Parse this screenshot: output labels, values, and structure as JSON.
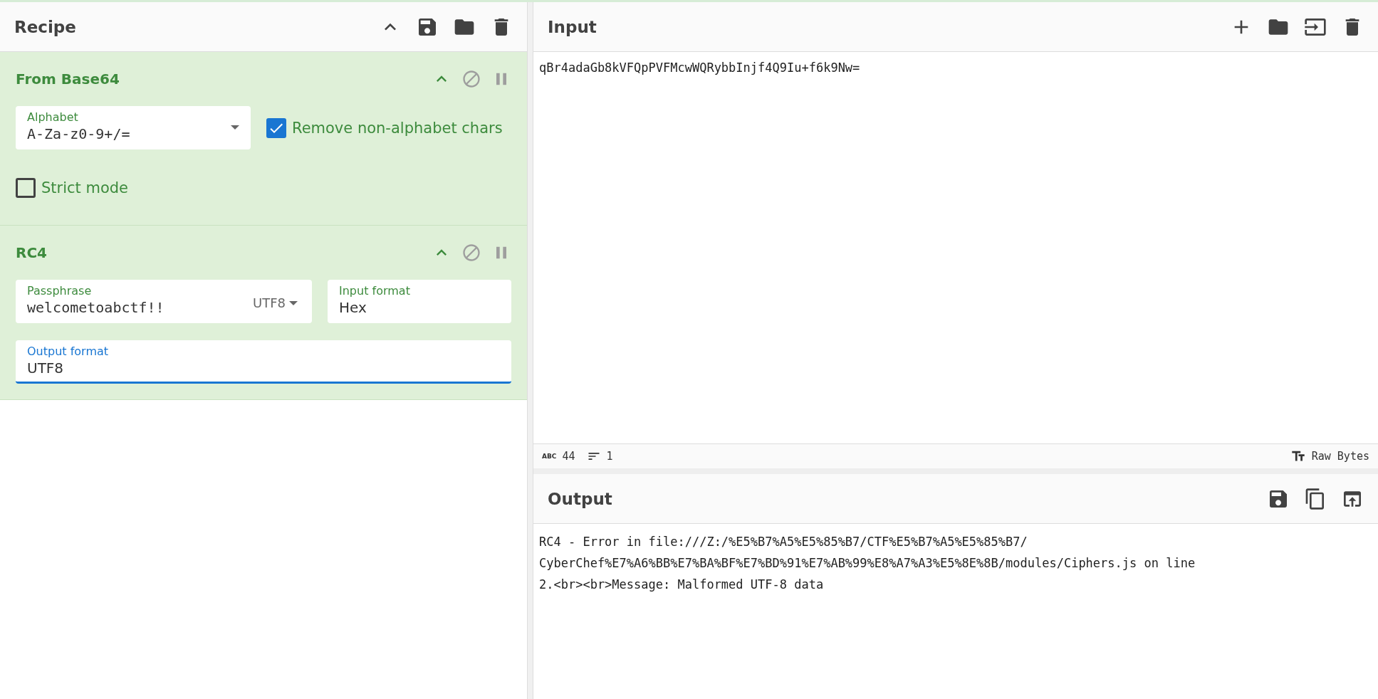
{
  "recipe": {
    "title": "Recipe"
  },
  "operations": [
    {
      "title": "From Base64",
      "rows": [
        [
          {
            "kind": "select",
            "label": "Alphabet",
            "value": "A-Za-z0-9+/=",
            "focused": false
          },
          {
            "kind": "checkbox",
            "label": "Remove non-alphabet chars",
            "checked": true
          }
        ],
        [
          {
            "kind": "checkbox",
            "label": "Strict mode",
            "checked": false
          }
        ]
      ]
    },
    {
      "title": "RC4",
      "rows": [
        [
          {
            "kind": "toggle_text",
            "label": "Passphrase",
            "value": "welcometoabctf!!",
            "toggle": "UTF8",
            "focused": false
          },
          {
            "kind": "text",
            "label": "Input format",
            "value": "Hex",
            "focused": false
          }
        ],
        [
          {
            "kind": "text",
            "label": "Output format",
            "value": "UTF8",
            "focused": true
          }
        ]
      ]
    }
  ],
  "input": {
    "title": "Input",
    "value": "qBr4adaGb8kVFQpPVFMcwWQRybbInjf4Q9Iu+f6k9Nw="
  },
  "status_bar": {
    "length_icon": "ABC",
    "length": "44",
    "lines": "1",
    "encoding": "Raw Bytes"
  },
  "output": {
    "title": "Output",
    "lines": [
      "RC4 - Error in file:///Z:/%E5%B7%A5%E5%85%B7/CTF%E5%B7%A5%E5%85%B7/",
      "CyberChef%E7%A6%BB%E7%BA%BF%E7%BD%91%E7%AB%99%E8%A7%A3%E5%8E%8B/modules/Ciphers.js on line",
      "2.<br><br>Message: Malformed UTF-8 data"
    ]
  }
}
